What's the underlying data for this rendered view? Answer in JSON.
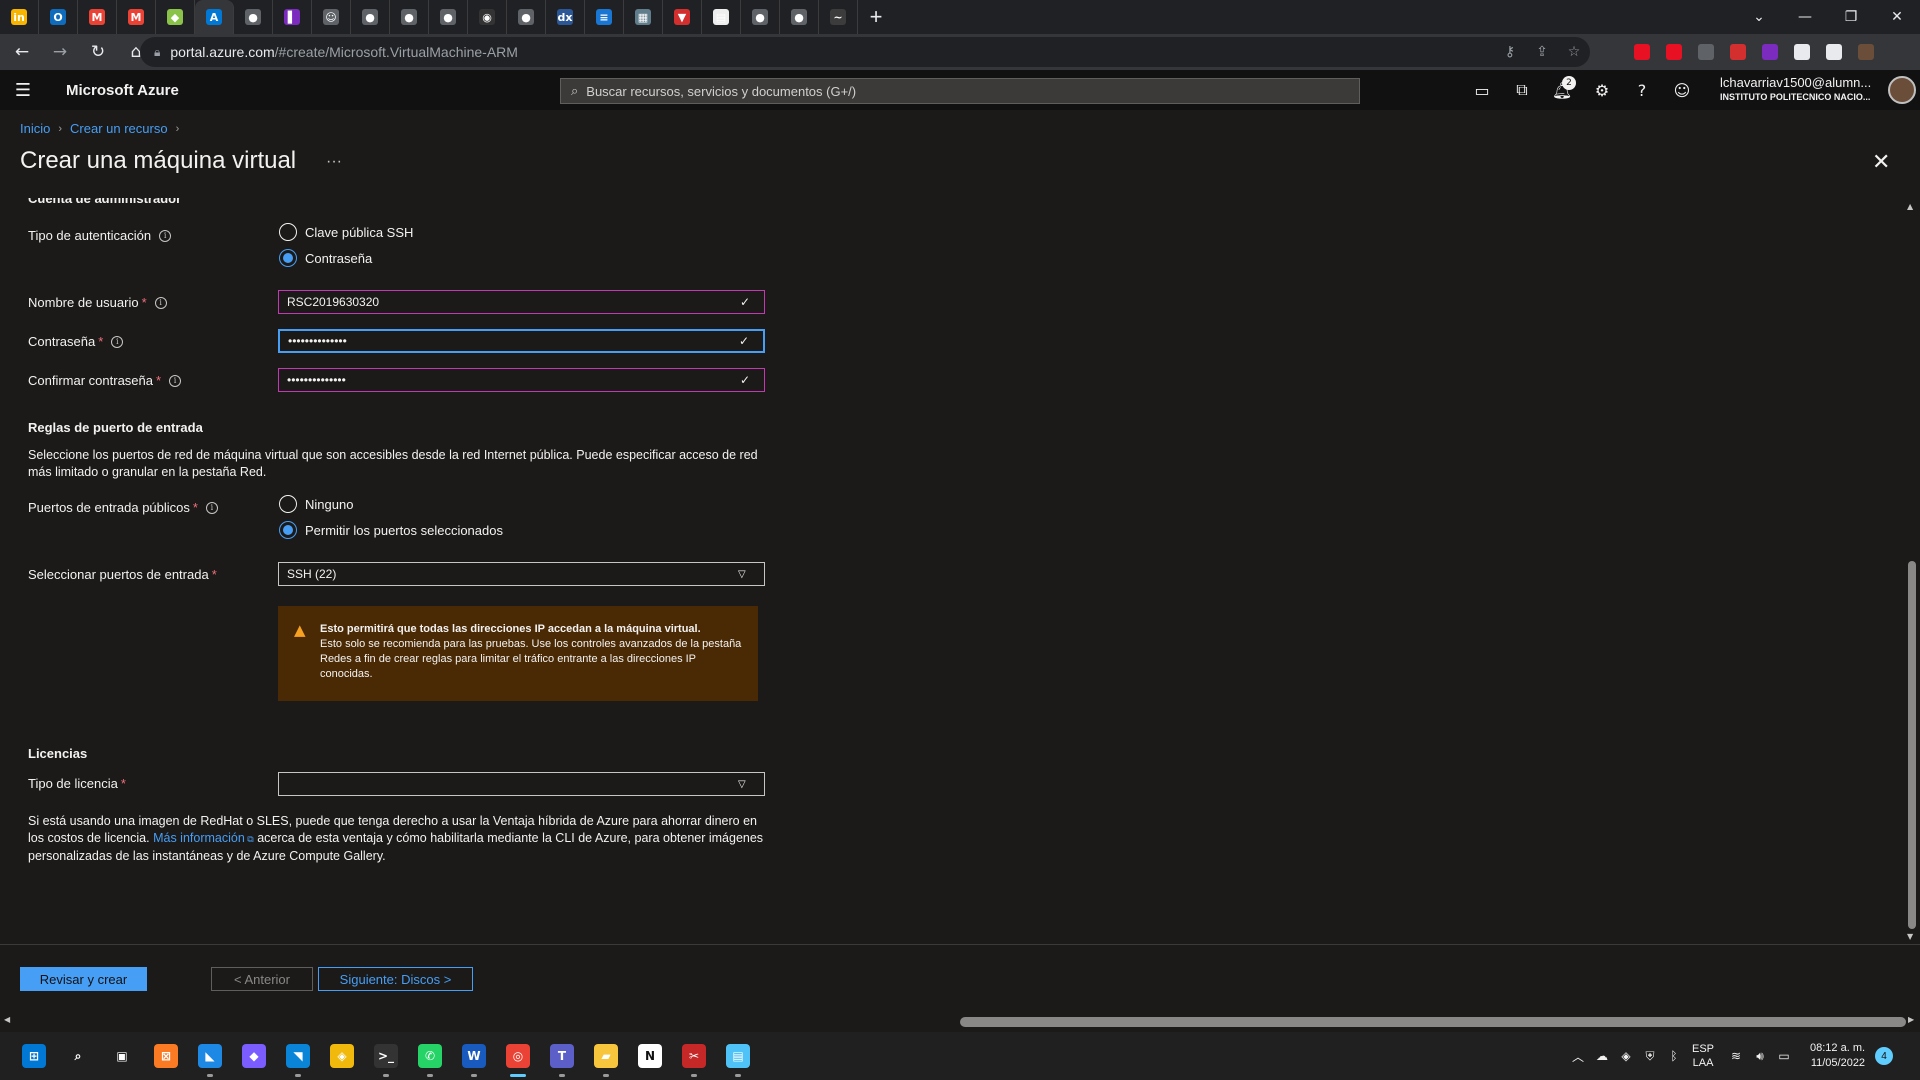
{
  "browser": {
    "tabs": [
      {
        "icon": "in",
        "color": "#f7b500",
        "name": "tab-favicon-in"
      },
      {
        "icon": "O",
        "color": "#0f6cbd",
        "name": "tab-favicon-outlook"
      },
      {
        "icon": "M",
        "color": "#ea4335",
        "name": "tab-favicon-gmail-1"
      },
      {
        "icon": "M",
        "color": "#ea4335",
        "name": "tab-favicon-gmail-2"
      },
      {
        "icon": "◆",
        "color": "#8bc34a",
        "name": "tab-favicon-green"
      },
      {
        "icon": "A",
        "color": "#0078d4",
        "name": "tab-favicon-azure"
      },
      {
        "icon": "●",
        "color": "#5f6368",
        "name": "tab-favicon-globe-1"
      },
      {
        "icon": "▌",
        "color": "#7b2cbf",
        "name": "tab-favicon-purple"
      },
      {
        "icon": "☺",
        "color": "#5f6368",
        "name": "tab-favicon-user"
      },
      {
        "icon": "●",
        "color": "#5f6368",
        "name": "tab-favicon-globe-2"
      },
      {
        "icon": "●",
        "color": "#5f6368",
        "name": "tab-favicon-globe-3"
      },
      {
        "icon": "●",
        "color": "#5f6368",
        "name": "tab-favicon-globe-4"
      },
      {
        "icon": "◉",
        "color": "#333",
        "name": "tab-favicon-github"
      },
      {
        "icon": "●",
        "color": "#5f6368",
        "name": "tab-favicon-globe-5"
      },
      {
        "icon": "dx",
        "color": "#2b5797",
        "name": "tab-favicon-docs"
      },
      {
        "icon": "≡",
        "color": "#1976d2",
        "name": "tab-favicon-stripes"
      },
      {
        "icon": "▦",
        "color": "#607d8b",
        "name": "tab-favicon-grid"
      },
      {
        "icon": "▼",
        "color": "#d32f2f",
        "name": "tab-favicon-shield"
      },
      {
        "icon": "▤",
        "color": "#eeeeee",
        "name": "tab-favicon-doc"
      },
      {
        "icon": "●",
        "color": "#5f6368",
        "name": "tab-favicon-globe-6"
      },
      {
        "icon": "●",
        "color": "#5f6368",
        "name": "tab-favicon-globe-7"
      },
      {
        "icon": "~",
        "color": "#3c3c3c",
        "name": "tab-favicon-wave"
      }
    ],
    "url_host": "portal.azure.com",
    "url_path": "/#create/Microsoft.VirtualMachine-ARM",
    "extensions": [
      "#e81123",
      "#e81123",
      "#5f6368",
      "#d32f2f",
      "#7b2cbf",
      "#e8eaed",
      "#e8eaed",
      "#6a4e3a"
    ]
  },
  "azure": {
    "brand": "Microsoft Azure",
    "search_placeholder": "Buscar recursos, servicios y documentos (G+/)",
    "notification_count": "2",
    "account_name": "lchavarriav1500@alumn...",
    "account_org": "INSTITUTO POLITECNICO NACIO..."
  },
  "breadcrumb": [
    "Inicio",
    "Crear un recurso"
  ],
  "page_title": "Crear una máquina virtual",
  "form": {
    "admin_section": "Cuenta de administrador",
    "auth_type_label": "Tipo de autenticación",
    "auth_options": [
      "Clave pública SSH",
      "Contraseña"
    ],
    "auth_selected": "Contraseña",
    "username_label": "Nombre de usuario",
    "username_value": "RSC2019630320",
    "password_label": "Contraseña",
    "password_value": "••••••••••••••",
    "confirm_label": "Confirmar contraseña",
    "confirm_value": "••••••••••••••",
    "inbound_section": "Reglas de puerto de entrada",
    "inbound_desc": "Seleccione los puertos de red de máquina virtual que son accesibles desde la red Internet pública. Puede especificar acceso de red más limitado o granular en la pestaña Red.",
    "public_ports_label": "Puertos de entrada públicos",
    "port_options": [
      "Ninguno",
      "Permitir los puertos seleccionados"
    ],
    "port_selected": "Permitir los puertos seleccionados",
    "select_ports_label": "Seleccionar puertos de entrada",
    "select_ports_value": "SSH (22)",
    "warning_title": "Esto permitirá que todas las direcciones IP accedan a la máquina virtual.",
    "warning_body": "Esto solo se recomienda para las pruebas.  Use los controles avanzados de la pestaña Redes a fin de crear reglas para limitar el tráfico entrante a las direcciones IP conocidas.",
    "licenses_section": "Licencias",
    "license_type_label": "Tipo de licencia",
    "license_type_value": "",
    "license_desc_1": "Si está usando una imagen de RedHat o SLES, puede que tenga derecho a usar la Ventaja híbrida de Azure para ahorrar dinero en los costos de licencia.",
    "license_link": "Más información",
    "license_desc_2": "acerca de esta ventaja y cómo habilitarla mediante la CLI de Azure, para obtener imágenes personalizadas de las instantáneas y de Azure Compute Gallery."
  },
  "footer": {
    "review_create": "Revisar y crear",
    "previous": "< Anterior",
    "next": "Siguiente: Discos >"
  },
  "taskbar": {
    "apps": [
      {
        "name": "start-icon",
        "glyph": "⊞",
        "color": "#0078d4"
      },
      {
        "name": "search-icon",
        "glyph": "⌕",
        "color": "#202020"
      },
      {
        "name": "task-view-icon",
        "glyph": "▣",
        "color": "#202020"
      },
      {
        "name": "xampp-icon",
        "glyph": "⊠",
        "color": "#fb7a24"
      },
      {
        "name": "vscode-insiders-icon",
        "glyph": "◣",
        "color": "#1e88e5"
      },
      {
        "name": "git-icon",
        "glyph": "◆",
        "color": "#7b5cff"
      },
      {
        "name": "vscode-icon",
        "glyph": "◥",
        "color": "#0a84d6"
      },
      {
        "name": "binance-icon",
        "glyph": "◈",
        "color": "#f0b90b"
      },
      {
        "name": "terminal-icon",
        "glyph": ">_",
        "color": "#333333"
      },
      {
        "name": "whatsapp-icon",
        "glyph": "✆",
        "color": "#25d366"
      },
      {
        "name": "word-icon",
        "glyph": "W",
        "color": "#185abd"
      },
      {
        "name": "chrome-icon",
        "glyph": "◎",
        "color": "#ea4335"
      },
      {
        "name": "teams-icon",
        "glyph": "T",
        "color": "#5b5fc7"
      },
      {
        "name": "explorer-icon",
        "glyph": "▰",
        "color": "#f8c63d"
      },
      {
        "name": "notion-icon",
        "glyph": "N",
        "color": "#ffffff"
      },
      {
        "name": "snipping-icon",
        "glyph": "✂",
        "color": "#c62828"
      },
      {
        "name": "notepad-icon",
        "glyph": "▤",
        "color": "#4fc3f7"
      }
    ],
    "lang_1": "ESP",
    "lang_2": "LAA",
    "time": "08:12 a. m.",
    "date": "11/05/2022",
    "notif_count": "4"
  }
}
